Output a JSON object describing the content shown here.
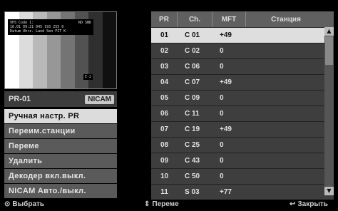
{
  "preview": {
    "osd_line1_left": "VPS Code 1:",
    "osd_line1_right": "NO SND",
    "osd_line2": "16.01 09:21  045 193 255 0",
    "osd_line3": "Datum Uhrz. Land Sen FIT K",
    "tag": "E-2"
  },
  "pr": {
    "label": "PR-01",
    "audio_badge": "NICAM"
  },
  "menu": {
    "items": [
      "Ручная настр. PR",
      "Переим.станции",
      "Переме",
      "Удалить",
      "Декодер вкл.выкл.",
      "NICAM Авто./выкл."
    ]
  },
  "table": {
    "headers": [
      "PR",
      "Ch.",
      "MFT",
      "Станция"
    ],
    "rows": [
      [
        "01",
        "C 01",
        "+49",
        ""
      ],
      [
        "02",
        "C 02",
        "0",
        ""
      ],
      [
        "03",
        "C 06",
        "0",
        ""
      ],
      [
        "04",
        "C 07",
        "+49",
        ""
      ],
      [
        "05",
        "C 09",
        "0",
        ""
      ],
      [
        "06",
        "C 11",
        "0",
        ""
      ],
      [
        "07",
        "C 19",
        "+49",
        ""
      ],
      [
        "08",
        "C 25",
        "0",
        ""
      ],
      [
        "09",
        "C 43",
        "0",
        ""
      ],
      [
        "10",
        "C 50",
        "0",
        ""
      ],
      [
        "11",
        "S 03",
        "+77",
        ""
      ]
    ]
  },
  "footer": {
    "select": "Выбрать",
    "move": "Переме",
    "close": "Закрыть"
  }
}
